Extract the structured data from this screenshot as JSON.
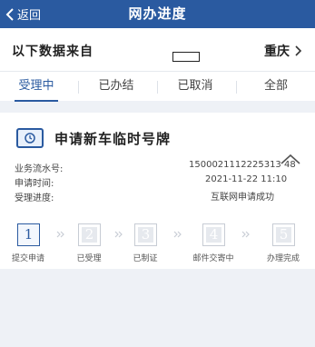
{
  "header": {
    "back_label": "返回",
    "title": "网办进度"
  },
  "source": {
    "label": "以下数据来自",
    "city": "重庆"
  },
  "tabs": [
    {
      "label": "受理中",
      "active": true
    },
    {
      "label": "已办结",
      "active": false
    },
    {
      "label": "已取消",
      "active": false
    },
    {
      "label": "全部",
      "active": false
    }
  ],
  "card": {
    "service_name": "申请新车临时号牌",
    "fields": [
      {
        "label": "业务流水号:",
        "value": "1500021112225313 48"
      },
      {
        "label": "申请时间:",
        "value": "2021-11-22 11:10"
      },
      {
        "label": "受理进度:",
        "value": "互联网申请成功"
      }
    ],
    "steps": [
      {
        "number": "1",
        "label": "提交申请",
        "active": true
      },
      {
        "number": "2",
        "label": "已受理",
        "active": false
      },
      {
        "number": "3",
        "label": "已制证",
        "active": false
      },
      {
        "number": "4",
        "label": "邮件交寄中",
        "active": false
      },
      {
        "number": "5",
        "label": "办理完成",
        "active": false
      }
    ]
  },
  "colors": {
    "primary": "#2a5aa0",
    "background": "#eef1f6"
  }
}
